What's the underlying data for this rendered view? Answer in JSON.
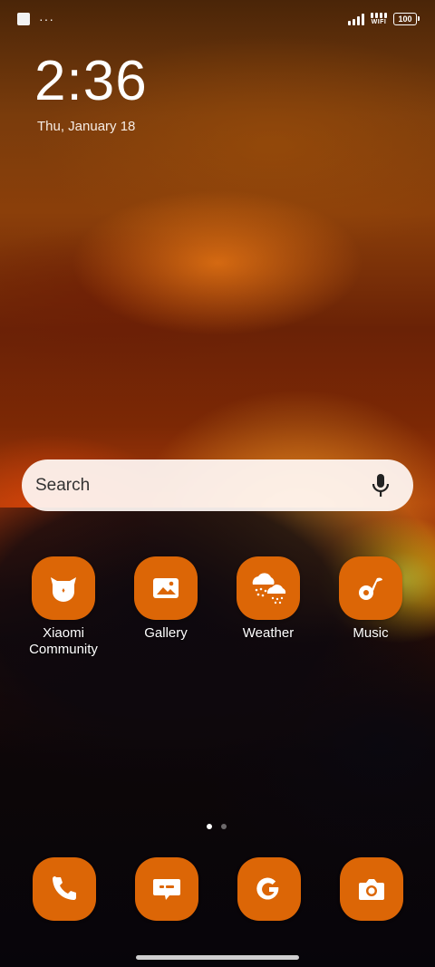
{
  "status_bar": {
    "battery": "100",
    "wifi_label": "WIFI",
    "more_label": "···",
    "icons": [
      "notification-square-icon",
      "more-dots-icon",
      "signal-icon",
      "wifi-icon",
      "battery-icon"
    ]
  },
  "clock": {
    "time": "2:36",
    "date": "Thu, January 18"
  },
  "search": {
    "placeholder": "Search",
    "icon": "mic-icon"
  },
  "apps": [
    {
      "label": "Xiaomi\nCommunity",
      "icon": "xiaomi-community-icon"
    },
    {
      "label": "Gallery",
      "icon": "gallery-icon"
    },
    {
      "label": "Weather",
      "icon": "weather-icon"
    },
    {
      "label": "Music",
      "icon": "music-icon"
    }
  ],
  "page_indicator": {
    "count": 2,
    "active": 0
  },
  "dock": [
    {
      "icon": "phone-icon"
    },
    {
      "icon": "messages-icon"
    },
    {
      "icon": "google-icon"
    },
    {
      "icon": "camera-icon"
    }
  ],
  "colors": {
    "app_icon_bg": "#dc6606",
    "search_bg": "#fff8f4"
  }
}
